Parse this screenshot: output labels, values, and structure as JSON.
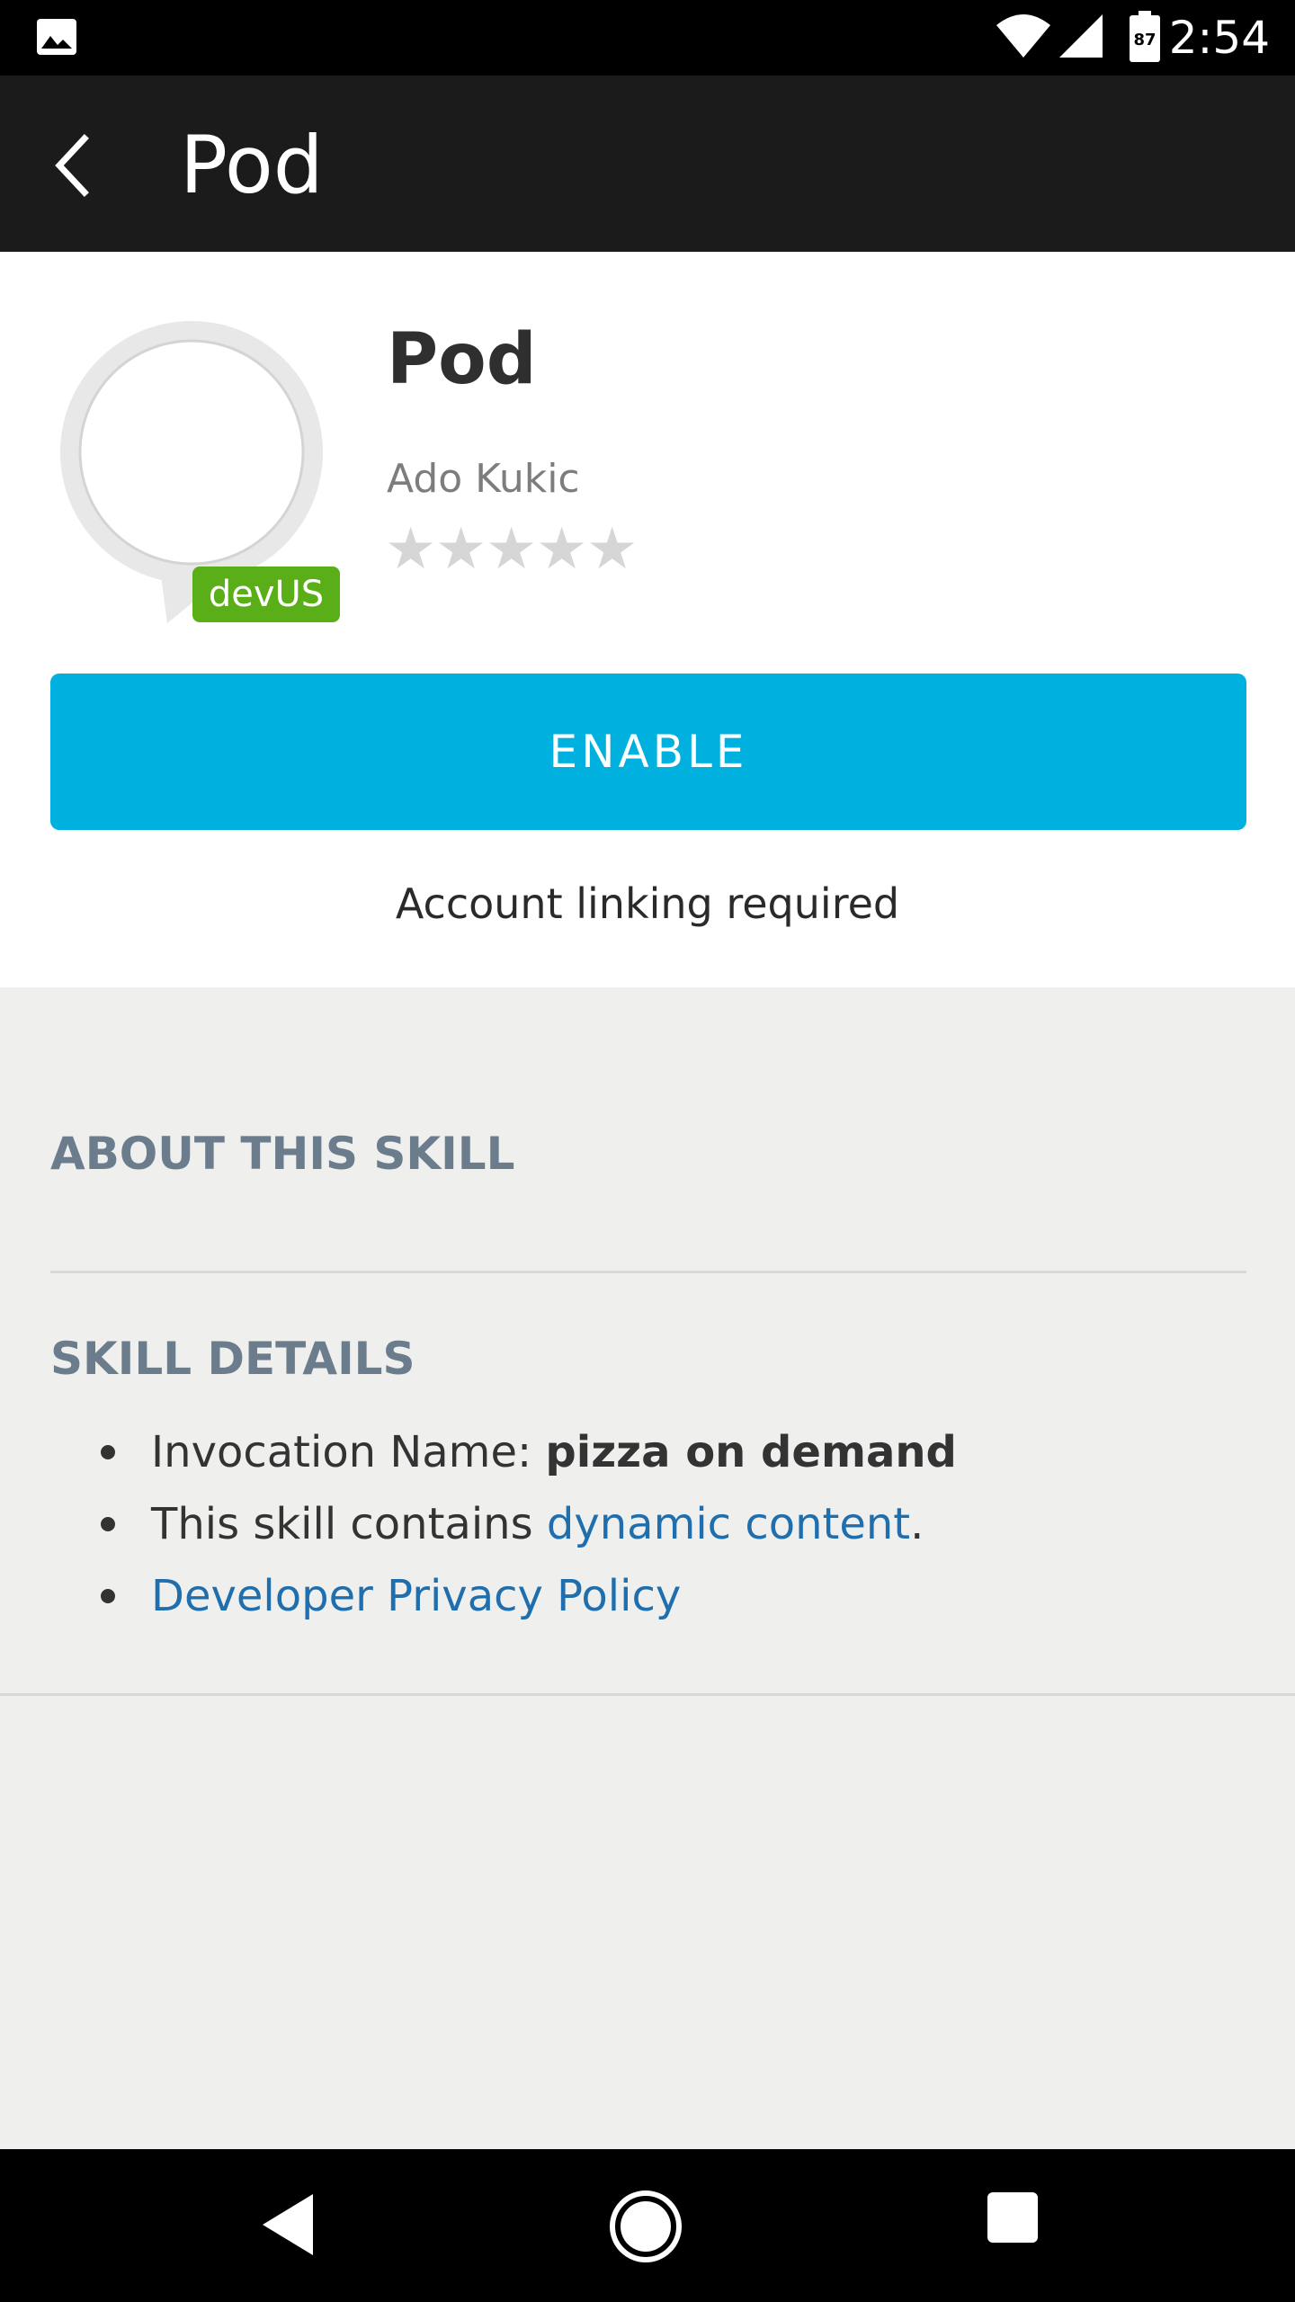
{
  "status_bar": {
    "time": "2:54",
    "battery_level": "87",
    "icons": [
      "image-icon",
      "wifi-icon",
      "signal-icon",
      "battery-icon"
    ]
  },
  "app_bar": {
    "back_icon": "back-arrow-icon",
    "title": "Pod"
  },
  "skill": {
    "name": "Pod",
    "author": "Ado Kukic",
    "badge": "devUS",
    "rating_stars": 0,
    "rating_max": 5,
    "star_glyph": "★"
  },
  "actions": {
    "enable_label": "ENABLE",
    "account_note": "Account linking required"
  },
  "sections": {
    "about_heading": "ABOUT THIS SKILL",
    "details_heading": "SKILL DETAILS"
  },
  "details": {
    "invocation_label": "Invocation Name: ",
    "invocation_value": "pizza on demand",
    "dynamic_prefix": "This skill contains ",
    "dynamic_link": "dynamic content",
    "dynamic_suffix": ".",
    "privacy_link": "Developer Privacy Policy"
  },
  "nav_bar": {
    "icons": [
      "nav-back-icon",
      "nav-home-icon",
      "nav-recents-icon"
    ]
  },
  "colors": {
    "accent": "#00b0de",
    "badge": "#5aae17",
    "link": "#1f6fae",
    "heading": "#6b7c8c"
  }
}
